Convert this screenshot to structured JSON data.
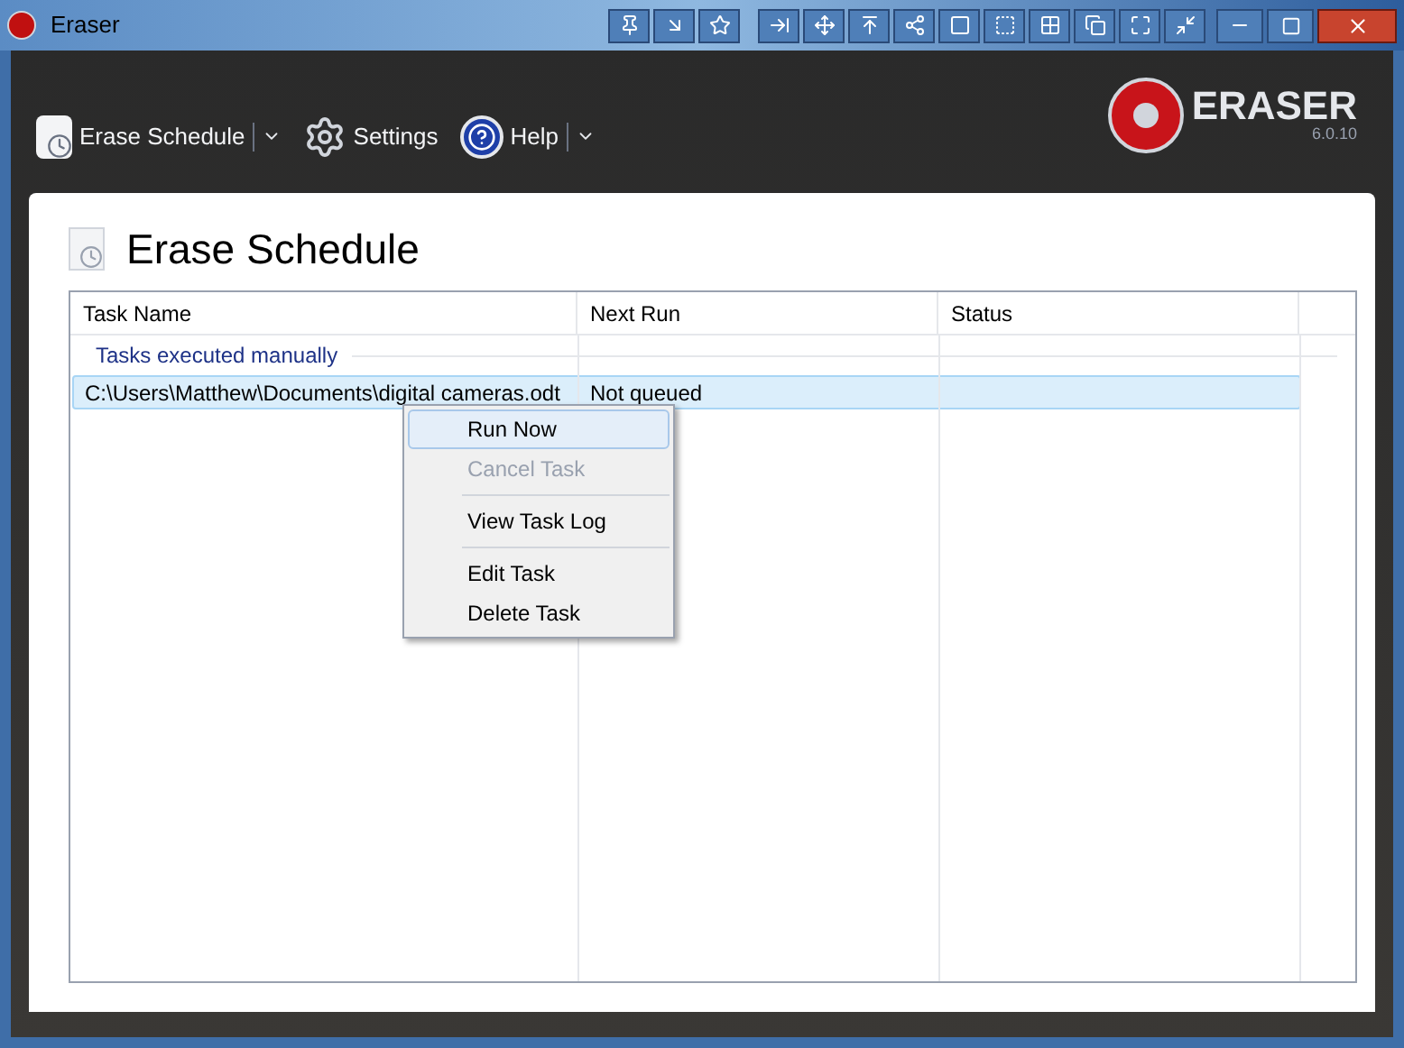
{
  "window": {
    "title": "Eraser"
  },
  "toolbar": [
    {
      "label": "Erase Schedule",
      "dropdown": true
    },
    {
      "label": "Settings",
      "dropdown": false
    },
    {
      "label": "Help",
      "dropdown": true
    }
  ],
  "logo": {
    "name": "ERASER",
    "version": "6.0.10"
  },
  "page": {
    "title": "Erase Schedule"
  },
  "table": {
    "columns": [
      "Task Name",
      "Next Run",
      "Status"
    ],
    "groups": [
      {
        "label": "Tasks executed manually",
        "rows": [
          {
            "cells": [
              "C:\\Users\\Matthew\\Documents\\digital cameras.odt",
              "Not queued"
            ],
            "selected": true
          }
        ]
      }
    ]
  },
  "context_menu": [
    {
      "label": "Run Now",
      "disabled": false,
      "selected": true,
      "separator_before": false
    },
    {
      "label": "Cancel Task",
      "disabled": true,
      "selected": false,
      "separator_before": false
    },
    {
      "label": "View Task Log",
      "disabled": false,
      "selected": false,
      "separator_before": true
    },
    {
      "label": "Edit Task",
      "disabled": false,
      "selected": false,
      "separator_before": true
    },
    {
      "label": "Delete Task",
      "disabled": false,
      "selected": false,
      "separator_before": false
    }
  ]
}
